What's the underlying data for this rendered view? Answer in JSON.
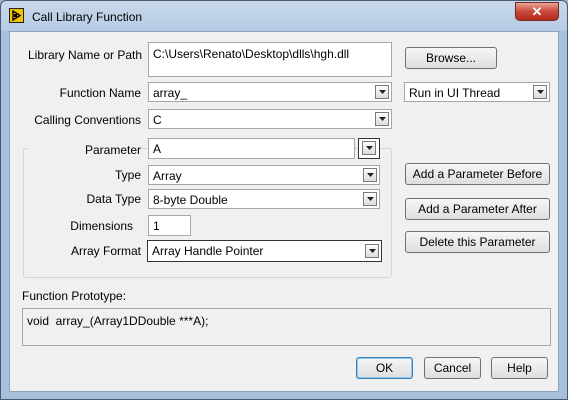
{
  "window": {
    "title": "Call Library Function",
    "close_glyph": "✕"
  },
  "form": {
    "library_label": "Library Name or Path",
    "library_value": "C:\\Users\\Renato\\Desktop\\dlls\\hgh.dll",
    "browse_label": "Browse...",
    "function_name_label": "Function Name",
    "function_name_value": "array_",
    "thread_value": "Run in UI Thread",
    "calling_conv_label": "Calling Conventions",
    "calling_conv_value": "C"
  },
  "parameter": {
    "parameter_label": "Parameter",
    "parameter_value": "A",
    "type_label": "Type",
    "type_value": "Array",
    "data_type_label": "Data Type",
    "data_type_value": "8-byte Double",
    "dimensions_label": "Dimensions",
    "dimensions_value": "1",
    "array_format_label": "Array Format",
    "array_format_value": "Array Handle Pointer"
  },
  "param_buttons": {
    "add_before": "Add a Parameter Before",
    "add_after": "Add a Parameter After",
    "delete": "Delete this Parameter"
  },
  "prototype": {
    "label": "Function Prototype:",
    "value": "void  array_(Array1DDouble ***A);"
  },
  "footer": {
    "ok": "OK",
    "cancel": "Cancel",
    "help": "Help"
  },
  "icons": {
    "app": "labview-icon",
    "dropdown": "chevron-down-icon",
    "close": "close-icon"
  },
  "colors": {
    "dialog_bg": "#f0f0f0",
    "close_red": "#c9483a",
    "default_button_border": "#3c7fb1"
  }
}
